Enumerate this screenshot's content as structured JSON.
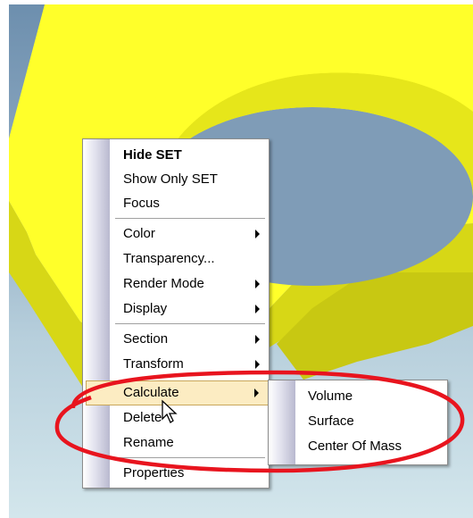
{
  "context_menu": {
    "items": [
      {
        "label": "Hide SET",
        "bold": true
      },
      {
        "label": "Show Only SET"
      },
      {
        "label": "Focus"
      },
      {
        "label": "Color",
        "submenu": true
      },
      {
        "label": "Transparency..."
      },
      {
        "label": "Render Mode",
        "submenu": true
      },
      {
        "label": "Display",
        "submenu": true
      },
      {
        "label": "Section",
        "submenu": true
      },
      {
        "label": "Transform",
        "submenu": true
      },
      {
        "label": "Calculate",
        "submenu": true,
        "highlighted": true
      },
      {
        "label": "Delete"
      },
      {
        "label": "Rename"
      },
      {
        "label": "Properties"
      }
    ]
  },
  "calculate_submenu": {
    "items": [
      {
        "label": "Volume"
      },
      {
        "label": "Surface"
      },
      {
        "label": "Center Of Mass"
      }
    ]
  },
  "colors": {
    "model": "#f2f21a",
    "highlight": "#fcecc2",
    "annotation": "#e8141e"
  },
  "icons": [
    "submenu-arrow-icon",
    "mouse-pointer-icon"
  ]
}
